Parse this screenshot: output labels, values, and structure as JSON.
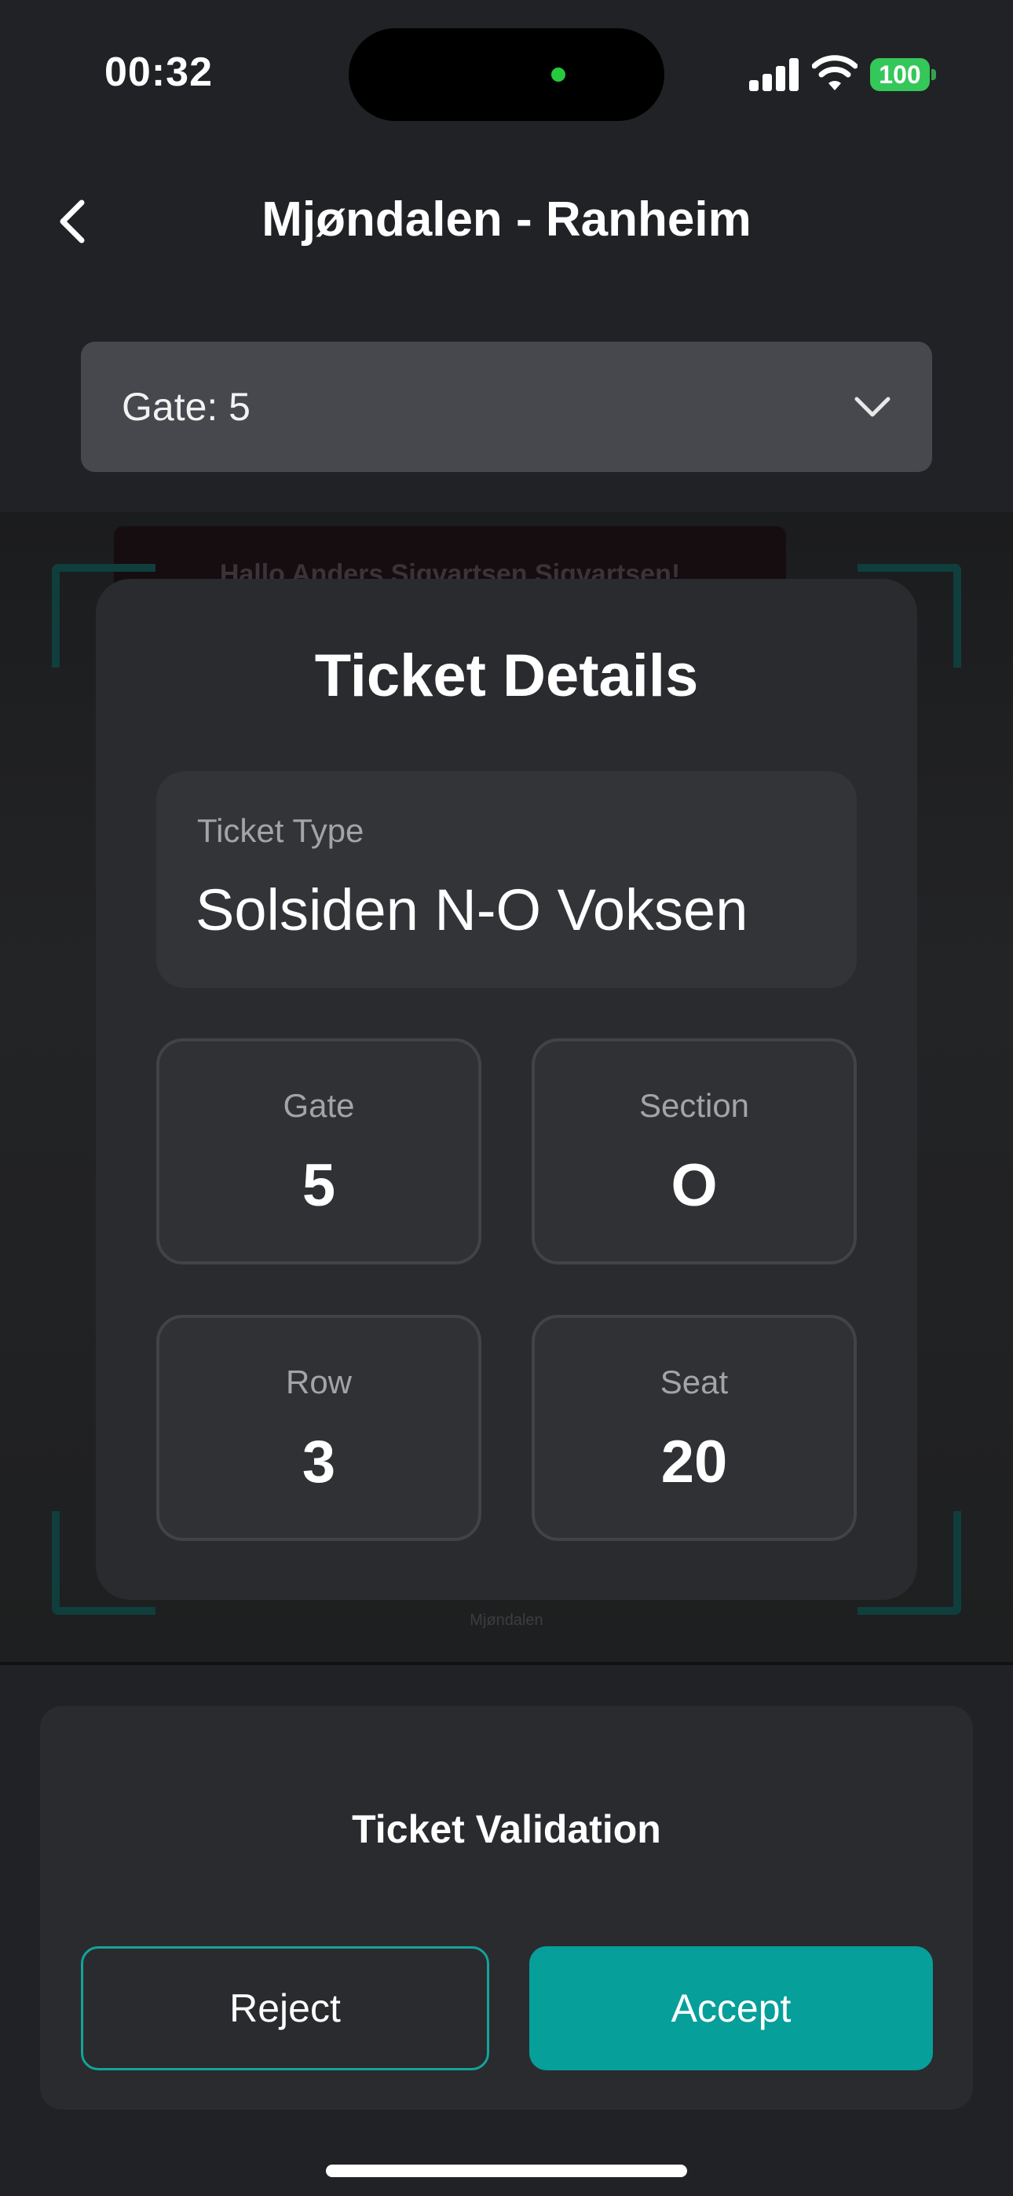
{
  "status_bar": {
    "time": "00:32",
    "battery": "100",
    "icons": [
      "cellular-signal-icon",
      "wifi-icon",
      "battery-icon"
    ]
  },
  "nav": {
    "title": "Mjøndalen - Ranheim",
    "back_icon": "chevron-left-icon"
  },
  "gate_selector": {
    "selected": "Gate: 5",
    "icon": "chevron-down-icon"
  },
  "background_scan": {
    "ticket_text": "Hallo Anders Sigvartsen Sigvartsen!",
    "footer_text": "Mjøndalen"
  },
  "ticket_details": {
    "title": "Ticket Details",
    "ticket_type_label": "Ticket Type",
    "ticket_type_value": "Solsiden N-O Voksen",
    "gate_label": "Gate",
    "gate_value": "5",
    "section_label": "Section",
    "section_value": "O",
    "row_label": "Row",
    "row_value": "3",
    "seat_label": "Seat",
    "seat_value": "20"
  },
  "validation": {
    "title": "Ticket Validation",
    "reject_label": "Reject",
    "accept_label": "Accept"
  },
  "colors": {
    "background": "#212225",
    "card": "#2a2b2e",
    "accent": "#069f9a",
    "battery": "#34c759",
    "scan_bracket": "#0f3e3d"
  }
}
